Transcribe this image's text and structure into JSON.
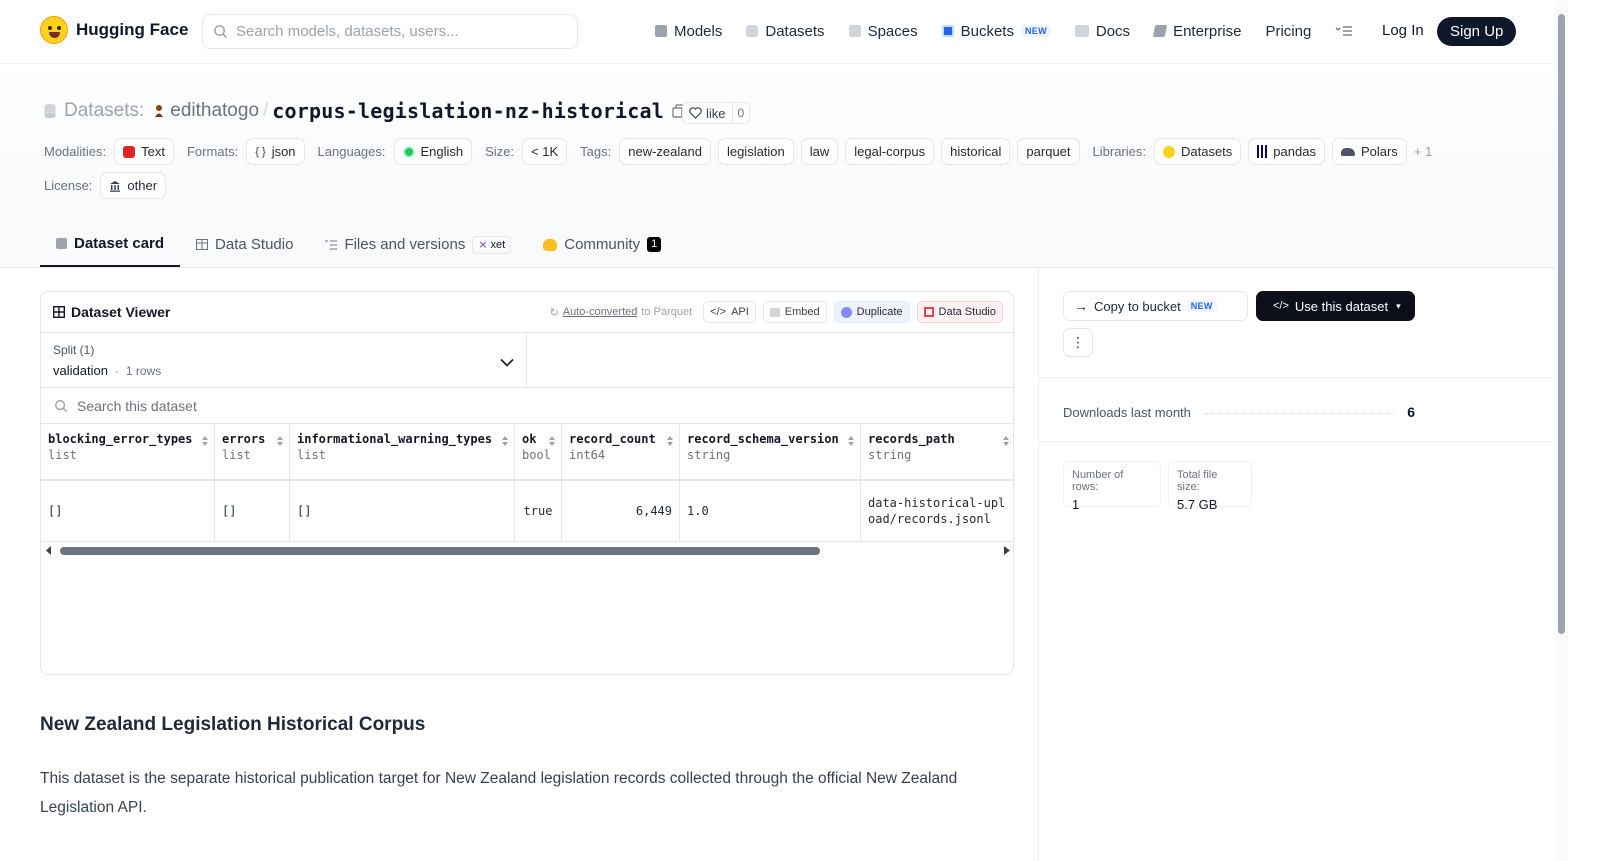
{
  "nav": {
    "brand": "Hugging Face",
    "search_placeholder": "Search models, datasets, users...",
    "links": [
      {
        "label": "Models"
      },
      {
        "label": "Datasets"
      },
      {
        "label": "Spaces"
      },
      {
        "label": "Buckets",
        "badge": "NEW"
      },
      {
        "label": "Docs"
      },
      {
        "label": "Enterprise"
      },
      {
        "label": "Pricing"
      }
    ],
    "login": "Log In",
    "signup": "Sign Up"
  },
  "repo": {
    "type_label": "Datasets:",
    "owner": "edithatogo",
    "separator": "/",
    "name": "corpus-legislation-nz-historical",
    "like_label": "like",
    "like_count": "0"
  },
  "meta": {
    "modalities_label": "Modalities:",
    "modality": "Text",
    "formats_label": "Formats:",
    "format": "json",
    "languages_label": "Languages:",
    "language": "English",
    "size_label": "Size:",
    "size": "< 1K",
    "tags_label": "Tags:",
    "tags": [
      "new-zealand",
      "legislation",
      "law",
      "legal-corpus",
      "historical",
      "parquet"
    ],
    "libraries_label": "Libraries:",
    "libraries": [
      "Datasets",
      "pandas",
      "Polars"
    ],
    "libraries_more": "+ 1",
    "license_label": "License:",
    "license": "other"
  },
  "tabs": [
    {
      "label": "Dataset card",
      "active": true
    },
    {
      "label": "Data Studio"
    },
    {
      "label": "Files and versions",
      "badge": "xet"
    },
    {
      "label": "Community",
      "count": "1"
    }
  ],
  "viewer": {
    "title": "Dataset Viewer",
    "auto_link": "Auto-converted",
    "auto_rest": "to Parquet",
    "buttons": {
      "api": "API",
      "embed": "Embed",
      "duplicate": "Duplicate",
      "data_studio": "Data Studio"
    },
    "split_label": "Split (1)",
    "split_value": "validation",
    "split_rows": "1 rows",
    "search_placeholder": "Search this dataset",
    "columns": [
      {
        "name": "blocking_error_types",
        "type": "list"
      },
      {
        "name": "errors",
        "type": "list"
      },
      {
        "name": "informational_warning_types",
        "type": "list"
      },
      {
        "name": "ok",
        "type": "bool"
      },
      {
        "name": "record_count",
        "type": "int64"
      },
      {
        "name": "record_schema_version",
        "type": "string"
      },
      {
        "name": "records_path",
        "type": "string"
      }
    ],
    "rows": [
      [
        "[]",
        "[]",
        "[]",
        "true",
        "6,449",
        "1.0",
        "data-historical-upload/records.jsonl"
      ]
    ]
  },
  "card": {
    "heading": "New Zealand Legislation Historical Corpus",
    "paragraph": "This dataset is the separate historical publication target for New Zealand legislation records collected through the official New Zealand Legislation API."
  },
  "sidebar": {
    "copy_label": "Copy to bucket",
    "copy_badge": "NEW",
    "use_label": "Use this dataset",
    "downloads_label": "Downloads last month",
    "downloads_value": "6",
    "rows_label": "Number of rows:",
    "rows_value": "1",
    "size_label": "Total file size:",
    "size_value": "5.7 GB"
  },
  "colors": {
    "accent_dark": "#0b0f19",
    "text": "#1f2937",
    "muted": "#6b7280"
  }
}
